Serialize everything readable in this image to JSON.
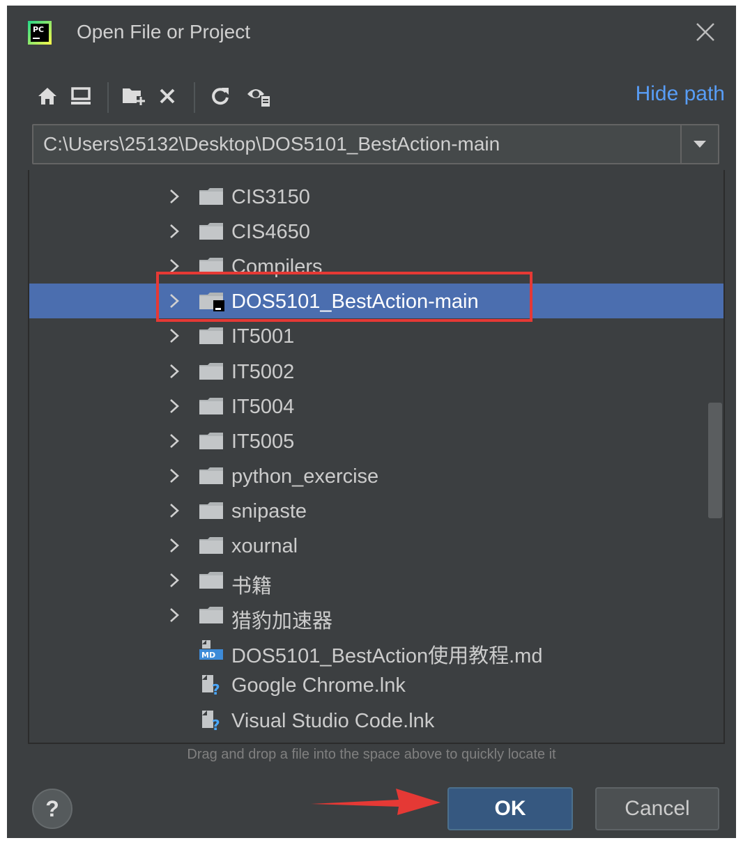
{
  "dialog": {
    "title": "Open File or Project",
    "app_logo_text": "PC"
  },
  "toolbar": {
    "buttons": [
      "home-icon",
      "desktop-icon",
      "new-folder-icon",
      "delete-icon",
      "refresh-icon",
      "show-hidden-icon"
    ],
    "hide_path_label": "Hide path"
  },
  "path": {
    "value": "C:\\Users\\25132\\Desktop\\DOS5101_BestAction-main"
  },
  "tree": {
    "items": [
      {
        "label": "CIS3150",
        "type": "folder",
        "expandable": true,
        "selected": false
      },
      {
        "label": "CIS4650",
        "type": "folder",
        "expandable": true,
        "selected": false
      },
      {
        "label": "Compilers",
        "type": "folder",
        "expandable": true,
        "selected": false
      },
      {
        "label": "DOS5101_BestAction-main",
        "type": "project-folder",
        "expandable": true,
        "selected": true
      },
      {
        "label": "IT5001",
        "type": "folder",
        "expandable": true,
        "selected": false
      },
      {
        "label": "IT5002",
        "type": "folder",
        "expandable": true,
        "selected": false
      },
      {
        "label": "IT5004",
        "type": "folder",
        "expandable": true,
        "selected": false
      },
      {
        "label": "IT5005",
        "type": "folder",
        "expandable": true,
        "selected": false
      },
      {
        "label": "python_exercise",
        "type": "folder",
        "expandable": true,
        "selected": false
      },
      {
        "label": "snipaste",
        "type": "folder",
        "expandable": true,
        "selected": false
      },
      {
        "label": "xournal",
        "type": "folder",
        "expandable": true,
        "selected": false
      },
      {
        "label": "书籍",
        "type": "folder",
        "expandable": true,
        "selected": false
      },
      {
        "label": "猎豹加速器",
        "type": "folder",
        "expandable": true,
        "selected": false
      },
      {
        "label": "DOS5101_BestAction使用教程.md",
        "type": "markdown-file",
        "expandable": false,
        "selected": false
      },
      {
        "label": "Google Chrome.lnk",
        "type": "unknown-file",
        "expandable": false,
        "selected": false
      },
      {
        "label": "Visual Studio Code.lnk",
        "type": "unknown-file",
        "expandable": false,
        "selected": false
      }
    ],
    "colors": {
      "selection": "#4b6eaf",
      "annotation": "#e53935"
    }
  },
  "footer": {
    "hint": "Drag and drop a file into the space above to quickly locate it",
    "help_label": "?",
    "ok_label": "OK",
    "cancel_label": "Cancel"
  }
}
